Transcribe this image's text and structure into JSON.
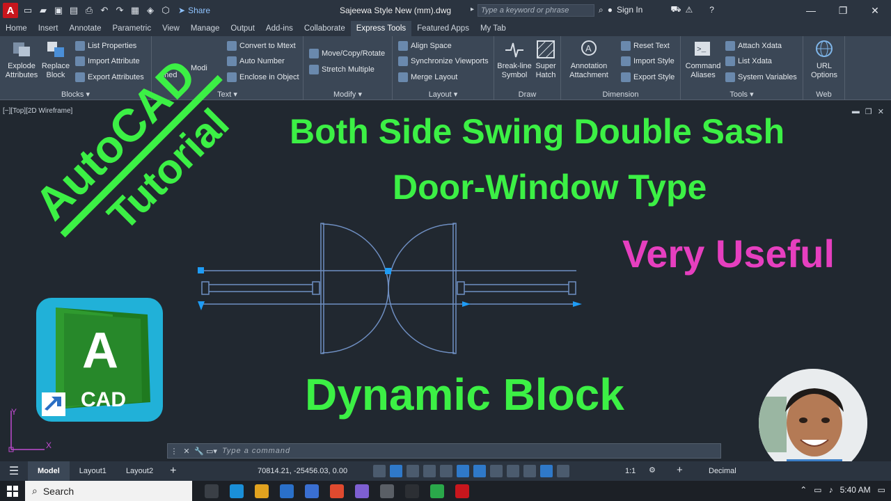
{
  "titlebar": {
    "app_letter": "A",
    "share_label": "Share",
    "document_title": "Sajeewa Style New (mm).dwg",
    "search_placeholder": "Type a keyword or phrase",
    "sign_in": "Sign In"
  },
  "tabs": [
    {
      "label": "Home"
    },
    {
      "label": "Insert"
    },
    {
      "label": "Annotate"
    },
    {
      "label": "Parametric"
    },
    {
      "label": "View"
    },
    {
      "label": "Manage"
    },
    {
      "label": "Output"
    },
    {
      "label": "Add-ins"
    },
    {
      "label": "Collaborate"
    },
    {
      "label": "Express Tools",
      "active": true
    },
    {
      "label": "Featured Apps"
    },
    {
      "label": "My Tab"
    }
  ],
  "ribbon": {
    "blocks": {
      "label": "Blocks",
      "explode": "Explode\nAttributes",
      "replace": "Replace\nBlock",
      "list_properties": "List Properties",
      "import_attributes": "Import Attribute",
      "export_attributes": "Export Attributes"
    },
    "text": {
      "label": "Text",
      "aligned": "gned",
      "modify": "Modi",
      "convert": "Convert to Mtext",
      "auto_number": "Auto Number",
      "enclose": "Enclose in Object"
    },
    "modify": {
      "label": "Modify",
      "move_copy_rotate": "Move/Copy/Rotate",
      "stretch_multiple": "Stretch Multiple"
    },
    "layout": {
      "label": "Layout",
      "align_space": "Align Space",
      "sync_viewports": "Synchronize Viewports",
      "merge_layout": "Merge Layout"
    },
    "draw": {
      "label": "Draw",
      "break_line": "Break-line\nSymbol",
      "super_hatch": "Super\nHatch"
    },
    "dimension": {
      "label": "Dimension",
      "annotation_attachment": "Annotation\nAttachment",
      "reset_text": "Reset Text",
      "import_style": "Import Style",
      "export_style": "Export Style"
    },
    "tools": {
      "label": "Tools",
      "command_aliases": "Command\nAliases",
      "attach_xdata": "Attach Xdata",
      "list_xdata": "List Xdata",
      "system_variables": "System Variables"
    },
    "web": {
      "label": "Web",
      "url_options": "URL\nOptions"
    }
  },
  "viewport": {
    "label": "[−][Top][2D Wireframe]"
  },
  "overlay": {
    "diagonal_1": "AutoCAD",
    "diagonal_2": "Tutorial",
    "title_line1": "Both Side Swing Double Sash",
    "title_line2": "Door-Window Type",
    "highlight": "Very Useful",
    "footer": "Dynamic Block",
    "logo_letter": "A",
    "logo_text": "CAD"
  },
  "ucs": {
    "x": "X",
    "y": "Y"
  },
  "command": {
    "placeholder": "Type a command"
  },
  "statusbar": {
    "tabs": [
      {
        "label": "Model",
        "active": true
      },
      {
        "label": "Layout1"
      },
      {
        "label": "Layout2"
      }
    ],
    "coords": "70814.21, -25456.03, 0.00",
    "scale": "1:1",
    "units": "Decimal"
  },
  "taskbar": {
    "search_label": "Search",
    "time": "5:40 AM"
  },
  "colors": {
    "green_text": "#3cf045",
    "pink_text": "#e63fbf",
    "canvas": "#212830",
    "ribbon": "#3b4756",
    "drawing_line": "#6f8fc2",
    "grip": "#1e9cf5"
  }
}
